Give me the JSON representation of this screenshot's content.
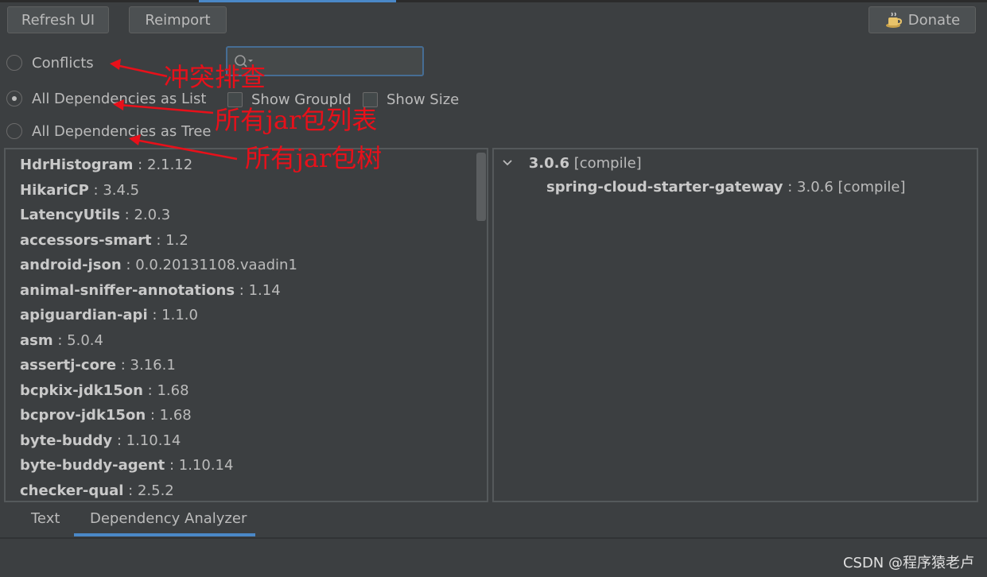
{
  "toolbar": {
    "refresh_label": "Refresh UI",
    "reimport_label": "Reimport",
    "donate_label": "Donate"
  },
  "modes": [
    {
      "label": "Conflicts",
      "selected": false
    },
    {
      "label": "All Dependencies as List",
      "selected": true
    },
    {
      "label": "All Dependencies as Tree",
      "selected": false
    }
  ],
  "search": {
    "value": "",
    "placeholder": ""
  },
  "options": {
    "show_groupid": "Show GroupId",
    "show_size": "Show Size"
  },
  "annotations": {
    "conflicts": "冲突排查",
    "list": "所有jar包列表",
    "tree": "所有jar包树"
  },
  "dependencies": [
    {
      "name": "HdrHistogram",
      "version": "2.1.12"
    },
    {
      "name": "HikariCP",
      "version": "3.4.5"
    },
    {
      "name": "LatencyUtils",
      "version": "2.0.3"
    },
    {
      "name": "accessors-smart",
      "version": "1.2"
    },
    {
      "name": "android-json",
      "version": "0.0.20131108.vaadin1"
    },
    {
      "name": "animal-sniffer-annotations",
      "version": "1.14"
    },
    {
      "name": "apiguardian-api",
      "version": "1.1.0"
    },
    {
      "name": "asm",
      "version": "5.0.4"
    },
    {
      "name": "assertj-core",
      "version": "3.16.1"
    },
    {
      "name": "bcpkix-jdk15on",
      "version": "1.68"
    },
    {
      "name": "bcprov-jdk15on",
      "version": "1.68"
    },
    {
      "name": "byte-buddy",
      "version": "1.10.14"
    },
    {
      "name": "byte-buddy-agent",
      "version": "1.10.14"
    },
    {
      "name": "checker-qual",
      "version": "2.5.2"
    }
  ],
  "tree": {
    "root_version": "3.0.6",
    "root_scope": "[compile]",
    "child_name": "spring-cloud-starter-gateway",
    "child_detail": "3.0.6 [compile]"
  },
  "tabs": [
    {
      "label": "Text",
      "active": false
    },
    {
      "label": "Dependency Analyzer",
      "active": true
    }
  ],
  "watermark": "CSDN @程序猿老卢",
  "colors": {
    "accent": "#4a88c7",
    "annotation": "#e8101a",
    "background": "#3c3f41"
  }
}
